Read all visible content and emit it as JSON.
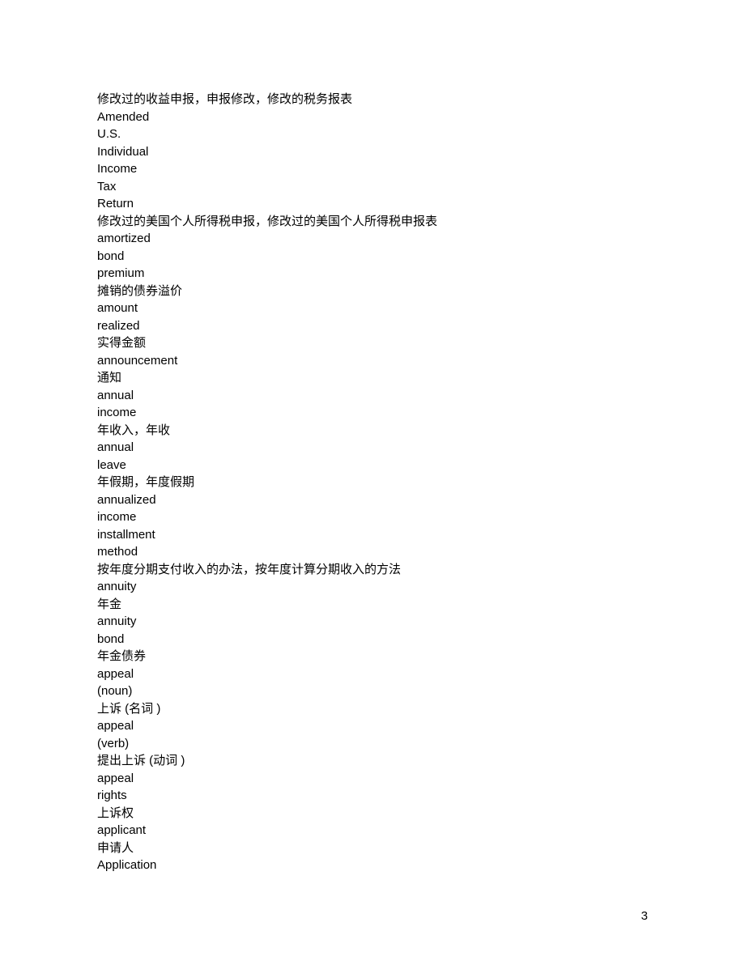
{
  "lines": [
    "修改过的收益申报，申报修改，修改的税务报表",
    "Amended",
    "U.S.",
    "Individual",
    "Income",
    "Tax",
    "Return",
    "修改过的美国个人所得税申报，修改过的美国个人所得税申报表",
    "amortized",
    "bond",
    "premium",
    "摊销的债券溢价",
    "amount",
    "realized",
    "实得金额",
    "announcement",
    "通知",
    "annual",
    "income",
    "年收入，年收",
    "annual",
    "leave",
    "年假期，年度假期",
    "annualized",
    "income",
    "installment",
    "method",
    "按年度分期支付收入的办法，按年度计算分期收入的方法",
    "annuity",
    "年金",
    "annuity",
    "bond",
    "年金债券",
    "appeal",
    "(noun)",
    "上诉 (名词 )",
    "appeal",
    "(verb)",
    "提出上诉 (动词 )",
    "appeal",
    "rights",
    "上诉权",
    "applicant",
    "申请人",
    "Application"
  ],
  "pageNumber": "3"
}
